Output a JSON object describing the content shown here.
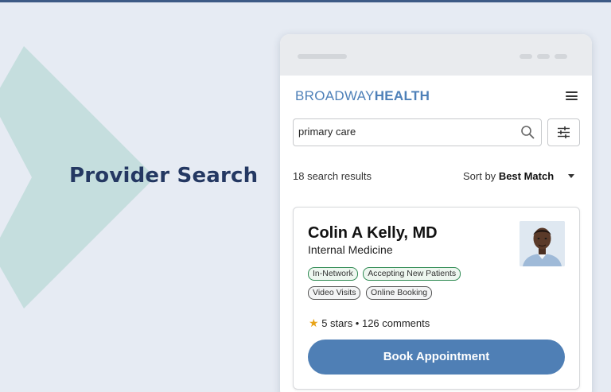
{
  "hero": {
    "title": "Provider Search"
  },
  "app": {
    "logo_light": "BROADWAY",
    "logo_bold": "HEALTH"
  },
  "search": {
    "value": "primary care"
  },
  "results": {
    "count_text": "18 search results",
    "sort_prefix": "Sort by",
    "sort_value": "Best Match"
  },
  "provider": {
    "name": "Colin A Kelly, MD",
    "specialty": "Internal Medicine",
    "tags": [
      {
        "label": "In-Network",
        "style": "green"
      },
      {
        "label": "Accepting New Patients",
        "style": "green"
      },
      {
        "label": "Video Visits",
        "style": "gray"
      },
      {
        "label": "Online Booking",
        "style": "gray"
      }
    ],
    "rating_star": "★",
    "rating_text": "5 stars • 126 comments",
    "book_label": "Book Appointment"
  },
  "colors": {
    "background": "#e6ebf3",
    "hero_text": "#243862",
    "accent": "#4f7fb5",
    "chevron": "#c5dede",
    "tag_green_border": "#2e8a52",
    "star": "#e8a317"
  }
}
